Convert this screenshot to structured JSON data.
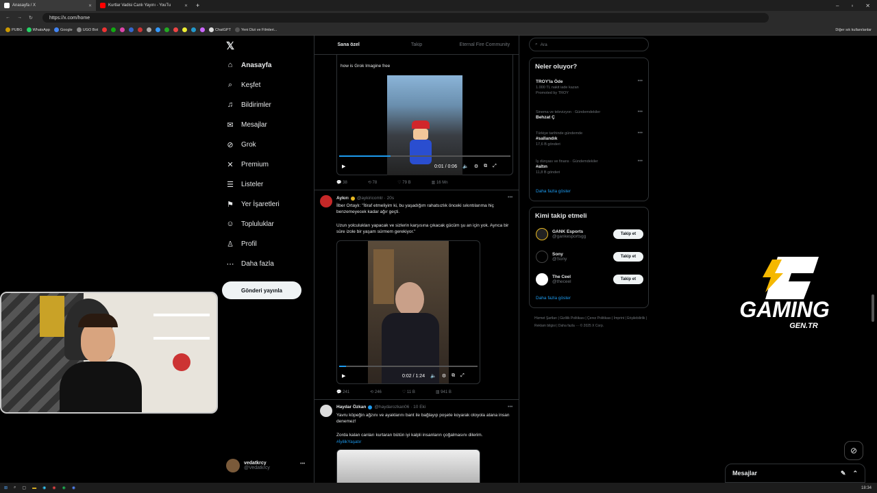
{
  "browser": {
    "tabs": [
      {
        "label": "Anasayfa / X",
        "active": true
      },
      {
        "label": "Kurtlar Vadisi Canlı Yayını - YouTu",
        "active": false
      }
    ],
    "url": "https://x.com/home",
    "bookmarks": [
      "PUBG",
      "WhatsApp",
      "Google",
      "UGO Bot",
      "ChatGPT",
      "Yeni Dizi ve Filmleri..."
    ],
    "bookmarks_right": "Diğer sık kullanılanlar"
  },
  "nav": {
    "items": [
      {
        "label": "Anasayfa",
        "icon": "home-icon",
        "glyph": "⌂"
      },
      {
        "label": "Keşfet",
        "icon": "search-icon",
        "glyph": "⌕"
      },
      {
        "label": "Bildirimler",
        "icon": "bell-icon",
        "glyph": "♫"
      },
      {
        "label": "Mesajlar",
        "icon": "mail-icon",
        "glyph": "✉"
      },
      {
        "label": "Grok",
        "icon": "grok-icon",
        "glyph": "⊘"
      },
      {
        "label": "Premium",
        "icon": "x-premium-icon",
        "glyph": "✕"
      },
      {
        "label": "Listeler",
        "icon": "list-icon",
        "glyph": "☰"
      },
      {
        "label": "Yer İşaretleri",
        "icon": "bookmark-icon",
        "glyph": "⚑"
      },
      {
        "label": "Topluluklar",
        "icon": "communities-icon",
        "glyph": "☺"
      },
      {
        "label": "Profil",
        "icon": "profile-icon",
        "glyph": "♙"
      },
      {
        "label": "Daha fazla",
        "icon": "more-circle-icon",
        "glyph": "⋯"
      }
    ],
    "post_button": "Gönderi yayınla",
    "user": {
      "name": "vedatkrcy",
      "handle": "@Vedatkrcy"
    }
  },
  "feed": {
    "tabs": [
      "Sana özel",
      "Takip",
      "Eternal Fire Community"
    ],
    "post1": {
      "text": "how is Grok Imagine free",
      "time": "0:01 / 0:06",
      "stats": [
        "38",
        "78",
        "79 B",
        "16 Mn"
      ]
    },
    "post2": {
      "author": "Aykırı",
      "handle": "@aykiricomtr · 20s",
      "text1": "İlber Ortaylı: \"İtiraf etmeliyim ki, bu yaşadığım rahatsızlık önceki sıkıntılarıma hiç benzemeyecek kadar ağır geçti.",
      "text2": "Uzun yolculukları yapacak ve sizlerin karşısına çıkacak gücüm şu an için yok. Ayrıca bir süre izole bir yaşam sürmem gerekiyor.\"",
      "time": "0:02 / 1:24",
      "stats": [
        "241",
        "246",
        "11 B",
        "941 B"
      ]
    },
    "post3": {
      "author": "Haydar Özkan",
      "handle": "@haydarozkan06 · 10 Eki",
      "text1": "Yavru köpeğin ağzını ve ayaklarını bant ile bağlayıp poşete koyarak otoyola atana insan denemez!",
      "text2": "Zorda kalan canları kurtaran bütün iyi kalpli insanların çoğalmasını dilerim.",
      "hashtag": "#İyilikYaşatır"
    }
  },
  "right": {
    "search_placeholder": "Ara",
    "trends_title": "Neler oluyor?",
    "trends": [
      {
        "context": "",
        "title": "TROY'la Öde",
        "sub": "1.000 TL nakit iade kazan",
        "extra": "Promoted by TROY"
      },
      {
        "context": "Sinema ve televizyon · Gündemdekiler",
        "title": "Behzat Ç",
        "sub": "",
        "extra": ""
      },
      {
        "context": "Türkiye tarihinde gündemde",
        "title": "#sallandık",
        "sub": "17,6 B gönderi",
        "extra": ""
      },
      {
        "context": "İş dünyası ve finans · Gündemdekiler",
        "title": "#altın",
        "sub": "11,8 B gönderi",
        "extra": ""
      }
    ],
    "show_more": "Daha fazla göster",
    "follow_title": "Kimi takip etmeli",
    "follow": [
      {
        "name": "GANK Esports",
        "handle": "@gankesportsgg",
        "color": "#222"
      },
      {
        "name": "Sony",
        "handle": "@Sony",
        "color": "#000"
      },
      {
        "name": "The Ceel",
        "handle": "@theceel",
        "color": "#fff"
      }
    ],
    "follow_btn": "Takip et",
    "footer": "Hizmet Şartları | Gizlilik Politikası | Çerez Politikası | İmprint | Erişilebilirlik | Reklam bilgisi | Daha fazla ··· © 2025 X Corp."
  },
  "overlay": {
    "brand": "GAMING",
    "brand_sub": "GEN.TR",
    "messages_label": "Mesajlar",
    "clock": "18:34"
  }
}
